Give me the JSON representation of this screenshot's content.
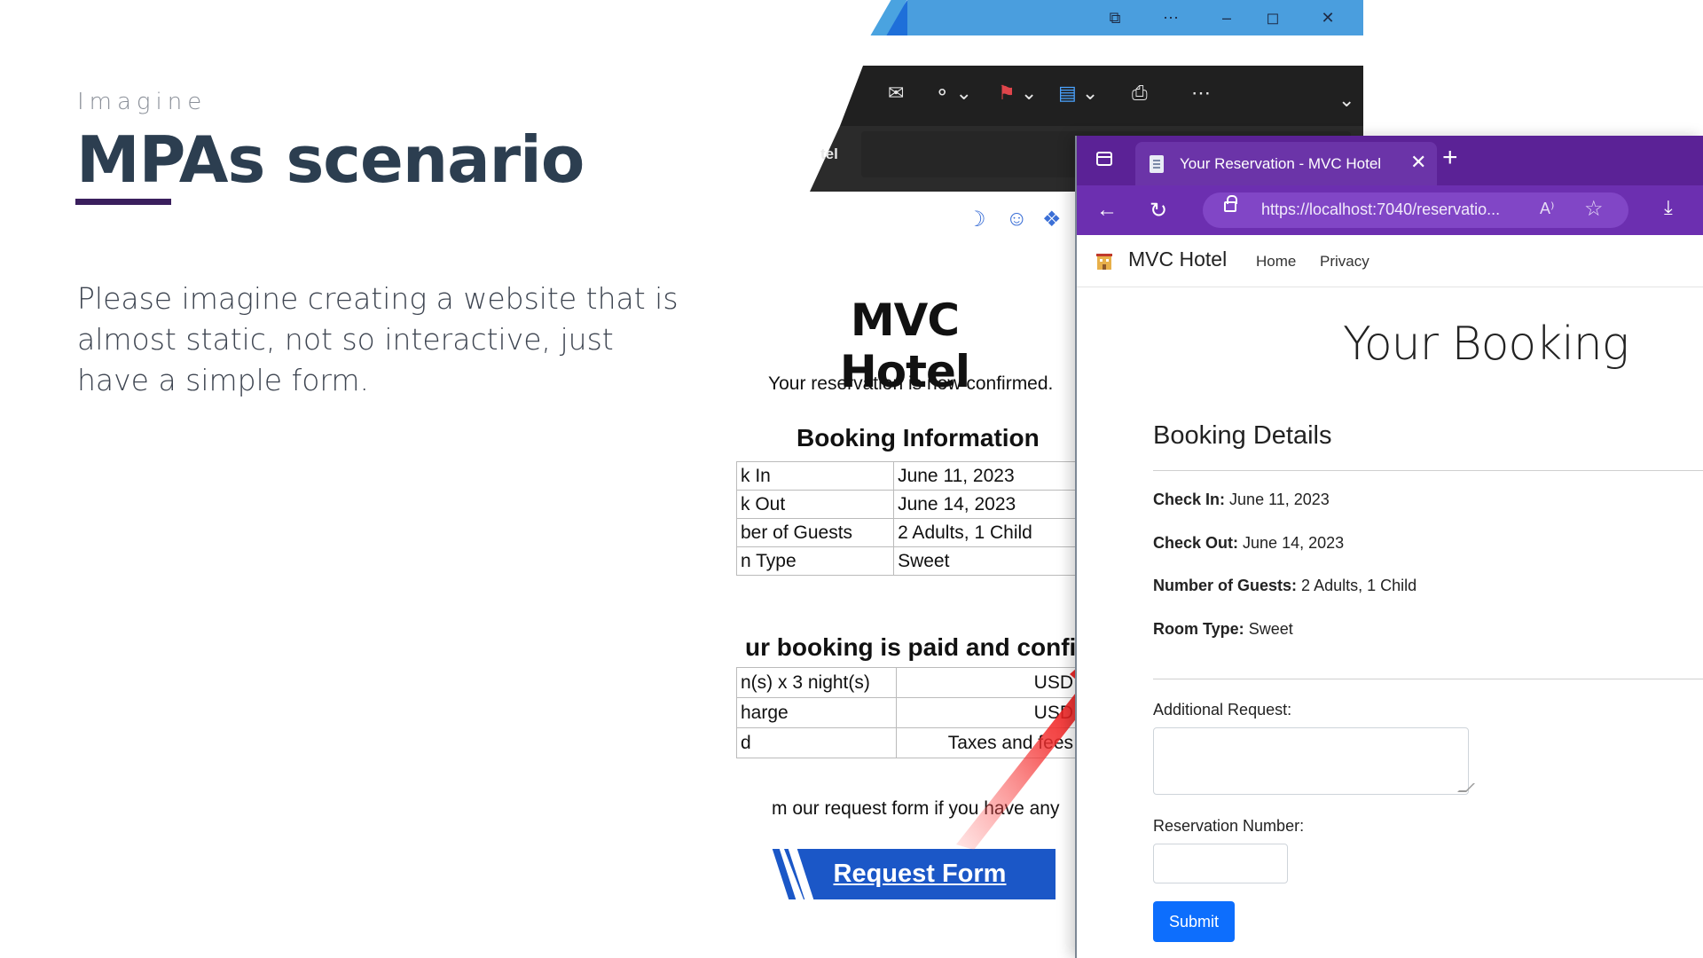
{
  "slide": {
    "eyebrow": "Imagine",
    "title": "MPAs scenario",
    "body": "Please imagine creating a website that is almost static, not so interactive, just have a simple form."
  },
  "mail_window": {
    "subject_fragment": "tel",
    "title_icons": [
      "window-snap-icon",
      "more-icon",
      "minimize-icon",
      "maximize-icon",
      "close-icon"
    ],
    "toolbar_icons": [
      "open-envelope-icon",
      "tag-icon",
      "flag-icon",
      "calendar-icon",
      "print-icon",
      "more-icon"
    ],
    "reaction_icons": [
      "moon-icon",
      "smiley-icon",
      "sticker-icon"
    ]
  },
  "email": {
    "hotel_name": "MVC Hotel",
    "confirm_text": "Your reservation is now confirmed.",
    "booking_heading": "Booking Information",
    "booking_rows": [
      [
        "k In",
        "June 11, 2023"
      ],
      [
        "k Out",
        "June 14, 2023"
      ],
      [
        "ber of Guests",
        "2 Adults, 1 Child"
      ],
      [
        "n Type",
        "Sweet"
      ]
    ],
    "paid_heading": "ur booking is paid and confir",
    "paid_rows": [
      [
        "n(s) x 3 night(s)",
        "USD"
      ],
      [
        "harge",
        "USD"
      ],
      [
        "d",
        "Taxes and fees"
      ]
    ],
    "footer_text": "m our request form if you have any",
    "request_button": "Request Form"
  },
  "browser": {
    "tab_title": "Your Reservation - MVC Hotel",
    "url": "https://localhost:7040/reservatio...",
    "read_aloud": "A⁾",
    "accent": "#6c2fb0"
  },
  "site": {
    "brand": "MVC Hotel",
    "nav": [
      "Home",
      "Privacy"
    ],
    "page_title": "Your Booking",
    "section_heading": "Booking Details",
    "details": [
      {
        "label": "Check In:",
        "value": "June 11, 2023"
      },
      {
        "label": "Check Out:",
        "value": "June 14, 2023"
      },
      {
        "label": "Number of Guests:",
        "value": "2 Adults, 1 Child"
      },
      {
        "label": "Room Type:",
        "value": "Sweet"
      }
    ],
    "form": {
      "additional_label": "Additional Request:",
      "additional_value": "",
      "reservation_label": "Reservation Number:",
      "reservation_value": "",
      "submit": "Submit"
    }
  }
}
